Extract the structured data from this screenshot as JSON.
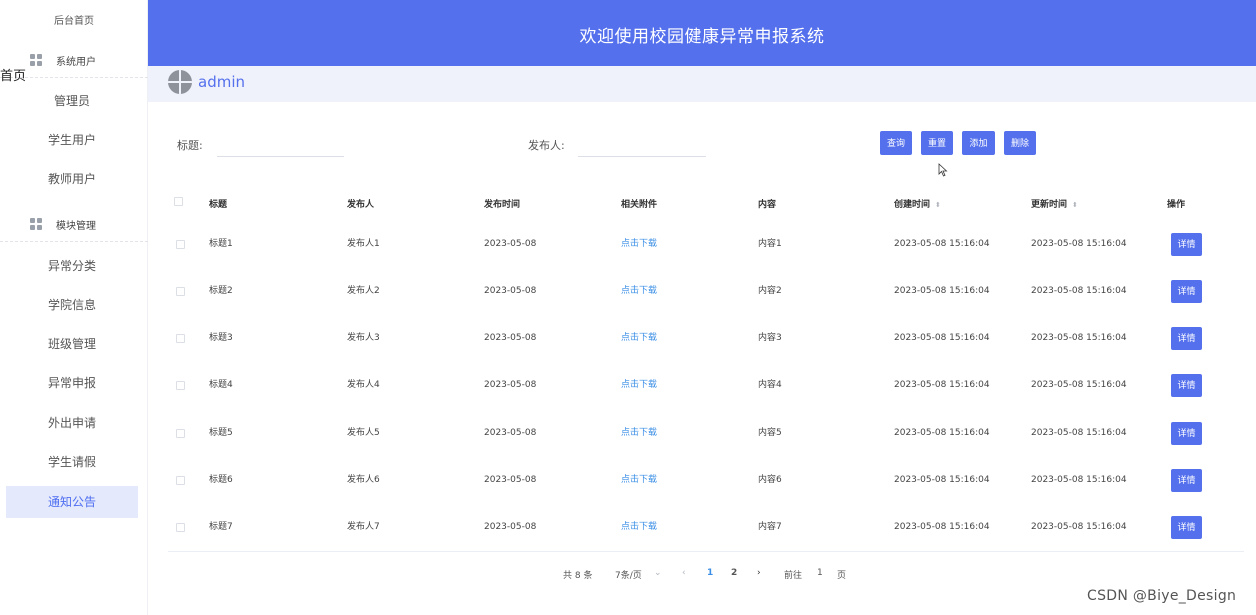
{
  "sidebar": {
    "home": "后台首页",
    "stray_text": "首页",
    "groups": [
      {
        "label": "系统用户",
        "items": [
          "管理员",
          "学生用户",
          "教师用户"
        ]
      },
      {
        "label": "模块管理",
        "items": [
          "异常分类",
          "学院信息",
          "班级管理",
          "异常申报",
          "外出申请",
          "学生请假",
          "通知公告"
        ]
      }
    ],
    "active_item": "通知公告"
  },
  "header": {
    "title": "欢迎使用校园健康异常申报系统"
  },
  "userbar": {
    "username": "admin"
  },
  "search": {
    "title_label": "标题:",
    "title_value": "",
    "publisher_label": "发布人:",
    "publisher_value": "",
    "buttons": {
      "query": "查询",
      "reset": "重置",
      "add": "添加",
      "delete": "删除"
    }
  },
  "table": {
    "headers": {
      "title": "标题",
      "publisher": "发布人",
      "publish_time": "发布时间",
      "attachment": "相关附件",
      "content": "内容",
      "created_at": "创建时间",
      "updated_at": "更新时间",
      "actions": "操作"
    },
    "sort_icon": "⬍",
    "rows": [
      {
        "title": "标题1",
        "publisher": "发布人1",
        "publish_time": "2023-05-08",
        "attachment": "点击下载",
        "content": "内容1",
        "created_at": "2023-05-08 15:16:04",
        "updated_at": "2023-05-08 15:16:04",
        "action": "详情"
      },
      {
        "title": "标题2",
        "publisher": "发布人2",
        "publish_time": "2023-05-08",
        "attachment": "点击下载",
        "content": "内容2",
        "created_at": "2023-05-08 15:16:04",
        "updated_at": "2023-05-08 15:16:04",
        "action": "详情"
      },
      {
        "title": "标题3",
        "publisher": "发布人3",
        "publish_time": "2023-05-08",
        "attachment": "点击下载",
        "content": "内容3",
        "created_at": "2023-05-08 15:16:04",
        "updated_at": "2023-05-08 15:16:04",
        "action": "详情"
      },
      {
        "title": "标题4",
        "publisher": "发布人4",
        "publish_time": "2023-05-08",
        "attachment": "点击下载",
        "content": "内容4",
        "created_at": "2023-05-08 15:16:04",
        "updated_at": "2023-05-08 15:16:04",
        "action": "详情"
      },
      {
        "title": "标题5",
        "publisher": "发布人5",
        "publish_time": "2023-05-08",
        "attachment": "点击下载",
        "content": "内容5",
        "created_at": "2023-05-08 15:16:04",
        "updated_at": "2023-05-08 15:16:04",
        "action": "详情"
      },
      {
        "title": "标题6",
        "publisher": "发布人6",
        "publish_time": "2023-05-08",
        "attachment": "点击下载",
        "content": "内容6",
        "created_at": "2023-05-08 15:16:04",
        "updated_at": "2023-05-08 15:16:04",
        "action": "详情"
      },
      {
        "title": "标题7",
        "publisher": "发布人7",
        "publish_time": "2023-05-08",
        "attachment": "点击下载",
        "content": "内容7",
        "created_at": "2023-05-08 15:16:04",
        "updated_at": "2023-05-08 15:16:04",
        "action": "详情"
      }
    ]
  },
  "pagination": {
    "total": "共 8 条",
    "page_size": "7条/页",
    "page_size_arrow": "⌄",
    "prev": "‹",
    "pages": [
      "1",
      "2"
    ],
    "current_page": "1",
    "next": "›",
    "goto_prefix": "前往",
    "goto_value": "1",
    "goto_suffix": "页"
  },
  "watermark": "CSDN @Biye_Design",
  "colors": {
    "primary": "#5470ed",
    "link": "#3a8ee6",
    "active_bg": "#e4e9fb"
  }
}
